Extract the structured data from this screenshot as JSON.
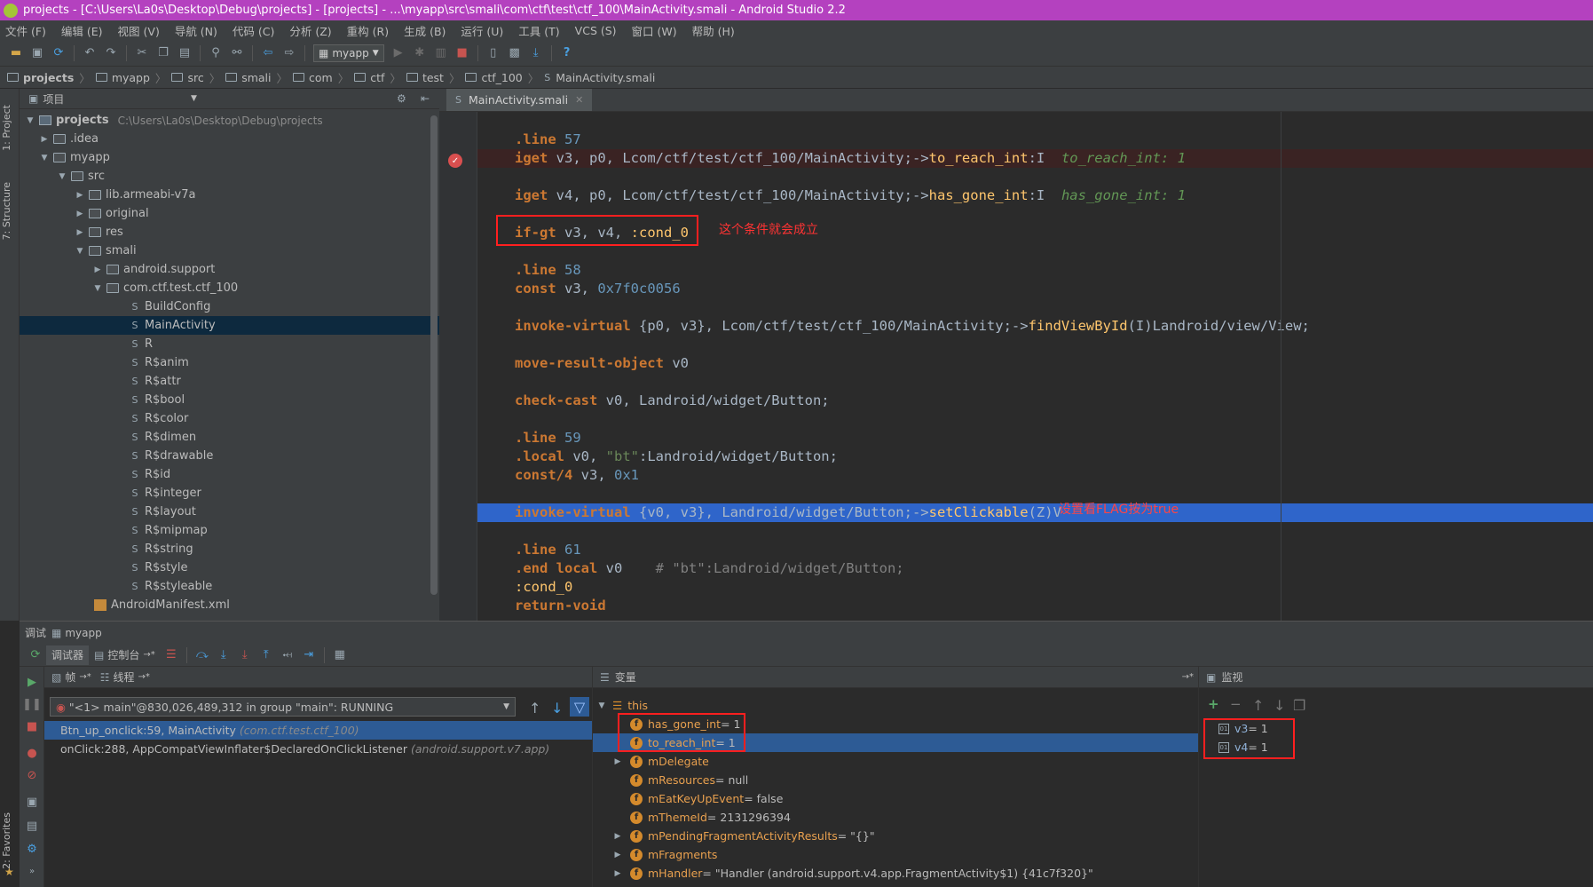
{
  "window": {
    "title": "projects - [C:\\Users\\La0s\\Desktop\\Debug\\projects] - [projects] - ...\\myapp\\src\\smali\\com\\ctf\\test\\ctf_100\\MainActivity.smali - Android Studio 2.2"
  },
  "menu": [
    "文件 (F)",
    "编辑 (E)",
    "视图 (V)",
    "导航 (N)",
    "代码 (C)",
    "分析 (Z)",
    "重构 (R)",
    "生成 (B)",
    "运行 (U)",
    "工具 (T)",
    "VCS (S)",
    "窗口 (W)",
    "帮助 (H)"
  ],
  "toolbar": {
    "run_config": "myapp"
  },
  "breadcrumbs": [
    "projects",
    "myapp",
    "src",
    "smali",
    "com",
    "ctf",
    "test",
    "ctf_100",
    "MainActivity.smali"
  ],
  "sidebar_tabs": {
    "project": "1: Project",
    "structure": "7: Structure",
    "favorites": "2: Favorites"
  },
  "project_panel": {
    "header": "项目",
    "tree": [
      {
        "label": "projects",
        "detail": "C:\\Users\\La0s\\Desktop\\Debug\\projects"
      },
      {
        "label": ".idea"
      },
      {
        "label": "myapp"
      },
      {
        "label": "src"
      },
      {
        "label": "lib.armeabi-v7a"
      },
      {
        "label": "original"
      },
      {
        "label": "res"
      },
      {
        "label": "smali"
      },
      {
        "label": "android.support"
      },
      {
        "label": "com.ctf.test.ctf_100"
      },
      {
        "label": "BuildConfig"
      },
      {
        "label": "MainActivity"
      },
      {
        "label": "R"
      },
      {
        "label": "R$anim"
      },
      {
        "label": "R$attr"
      },
      {
        "label": "R$bool"
      },
      {
        "label": "R$color"
      },
      {
        "label": "R$dimen"
      },
      {
        "label": "R$drawable"
      },
      {
        "label": "R$id"
      },
      {
        "label": "R$integer"
      },
      {
        "label": "R$layout"
      },
      {
        "label": "R$mipmap"
      },
      {
        "label": "R$string"
      },
      {
        "label": "R$style"
      },
      {
        "label": "R$styleable"
      },
      {
        "label": "AndroidManifest.xml"
      }
    ]
  },
  "editor": {
    "tab": "MainActivity.smali",
    "annotations": {
      "cond": "这个条件就会成立",
      "flag": "设置看FLAG按为true"
    },
    "lines": [
      {
        "kind": "line",
        "kw": ".line",
        "n": "57"
      },
      {
        "kind": "iget",
        "kw": "iget",
        "regs": " v3, p0, ",
        "cls": "Lcom/ctf/test/ctf_100/MainActivity;->",
        "field": "to_reach_int",
        "type": ":I",
        "hint": "to_reach_int: 1"
      },
      {
        "kind": "iget",
        "kw": "iget",
        "regs": " v4, p0, ",
        "cls": "Lcom/ctf/test/ctf_100/MainActivity;->",
        "field": "has_gone_int",
        "type": ":I",
        "hint": "has_gone_int: 1"
      },
      {
        "kind": "ifgt",
        "kw": "if-gt",
        "regs": " v3, v4, ",
        "label": ":cond_0"
      },
      {
        "kind": "line",
        "kw": ".line",
        "n": "58"
      },
      {
        "kind": "const",
        "kw": "const",
        "regs": " v3, ",
        "val": "0x7f0c0056"
      },
      {
        "kind": "invoke",
        "kw": "invoke-virtual",
        "regs": " {p0, v3}, ",
        "cls": "Lcom/ctf/test/ctf_100/MainActivity;->",
        "method": "findViewById",
        "sig": "(I)Landroid/view/View;"
      },
      {
        "kind": "move",
        "kw": "move-result-object",
        "regs": " v0"
      },
      {
        "kind": "check",
        "kw": "check-cast",
        "regs": " v0, ",
        "cls": "Landroid/widget/Button;"
      },
      {
        "kind": "line",
        "kw": ".line",
        "n": "59"
      },
      {
        "kind": "local",
        "kw": ".local",
        "regs": " v0, ",
        "str": "\"bt\"",
        "type": ":Landroid/widget/Button;"
      },
      {
        "kind": "const",
        "kw": "const/4",
        "regs": " v3, ",
        "val": "0x1"
      },
      {
        "kind": "invoke",
        "kw": "invoke-virtual",
        "regs": " {v0, v3}, ",
        "cls": "Landroid/widget/Button;->",
        "method": "setClickable",
        "sig": "(Z)V"
      },
      {
        "kind": "line",
        "kw": ".line",
        "n": "61"
      },
      {
        "kind": "endlocal",
        "kw": ".end local",
        "regs": " v0",
        "comment": "# \"bt\":Landroid/widget/Button;"
      },
      {
        "kind": "label",
        "label": ":cond_0"
      },
      {
        "kind": "ret",
        "kw": "return-void"
      }
    ]
  },
  "debug": {
    "title_prefix": "调试",
    "config": "myapp",
    "tabs": {
      "debugger": "调试器",
      "console": "控制台"
    },
    "frames": {
      "tab": "帧",
      "threads_tab": "线程",
      "thread": "\"<1> main\"@830,026,489,312 in group \"main\": RUNNING",
      "items": [
        {
          "method": "Btn_up_onclick:59, MainActivity",
          "pkg": "(com.ctf.test.ctf_100)"
        },
        {
          "method": "onClick:288, AppCompatViewInflater$DeclaredOnClickListener",
          "pkg": "(android.support.v7.app)"
        }
      ]
    },
    "variables": {
      "header": "变量",
      "root": "this",
      "items": [
        {
          "name": "has_gone_int",
          "value": " = 1"
        },
        {
          "name": "to_reach_int",
          "value": " = 1"
        },
        {
          "name": "mDelegate",
          "value": ""
        },
        {
          "name": "mResources",
          "value": " = null"
        },
        {
          "name": "mEatKeyUpEvent",
          "value": " = false"
        },
        {
          "name": "mThemeId",
          "value": " = 2131296394"
        },
        {
          "name": "mPendingFragmentActivityResults",
          "value": " = \"{}\""
        },
        {
          "name": "mFragments",
          "value": ""
        },
        {
          "name": "mHandler",
          "value": " = \"Handler (android.support.v4.app.FragmentActivity$1) {41c7f320}\""
        }
      ]
    },
    "watches": {
      "header": "监视",
      "items": [
        {
          "name": "v3",
          "value": " = 1"
        },
        {
          "name": "v4",
          "value": " = 1"
        }
      ]
    }
  }
}
